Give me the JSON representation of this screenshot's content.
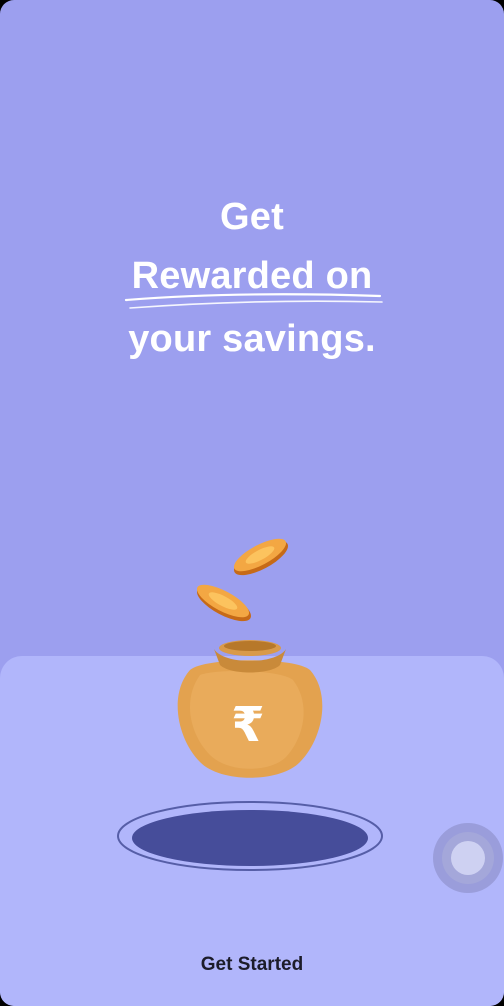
{
  "headline": {
    "line1": "Get",
    "line2": "Rewarded on",
    "line3": "your savings."
  },
  "illustration": {
    "currency_symbol": "₹",
    "icons": [
      "coin-icon",
      "money-bag-icon",
      "portal-hole-icon"
    ]
  },
  "actions": {
    "get_started": "Get Started"
  },
  "colors": {
    "background": "#9c9fef",
    "floor": "#b1b6fb",
    "bag": "#e2a34f",
    "coin": "#f2a33a",
    "hole": "#464d9a",
    "text_primary": "#ffffff",
    "cta_text": "#1c1c2a"
  }
}
